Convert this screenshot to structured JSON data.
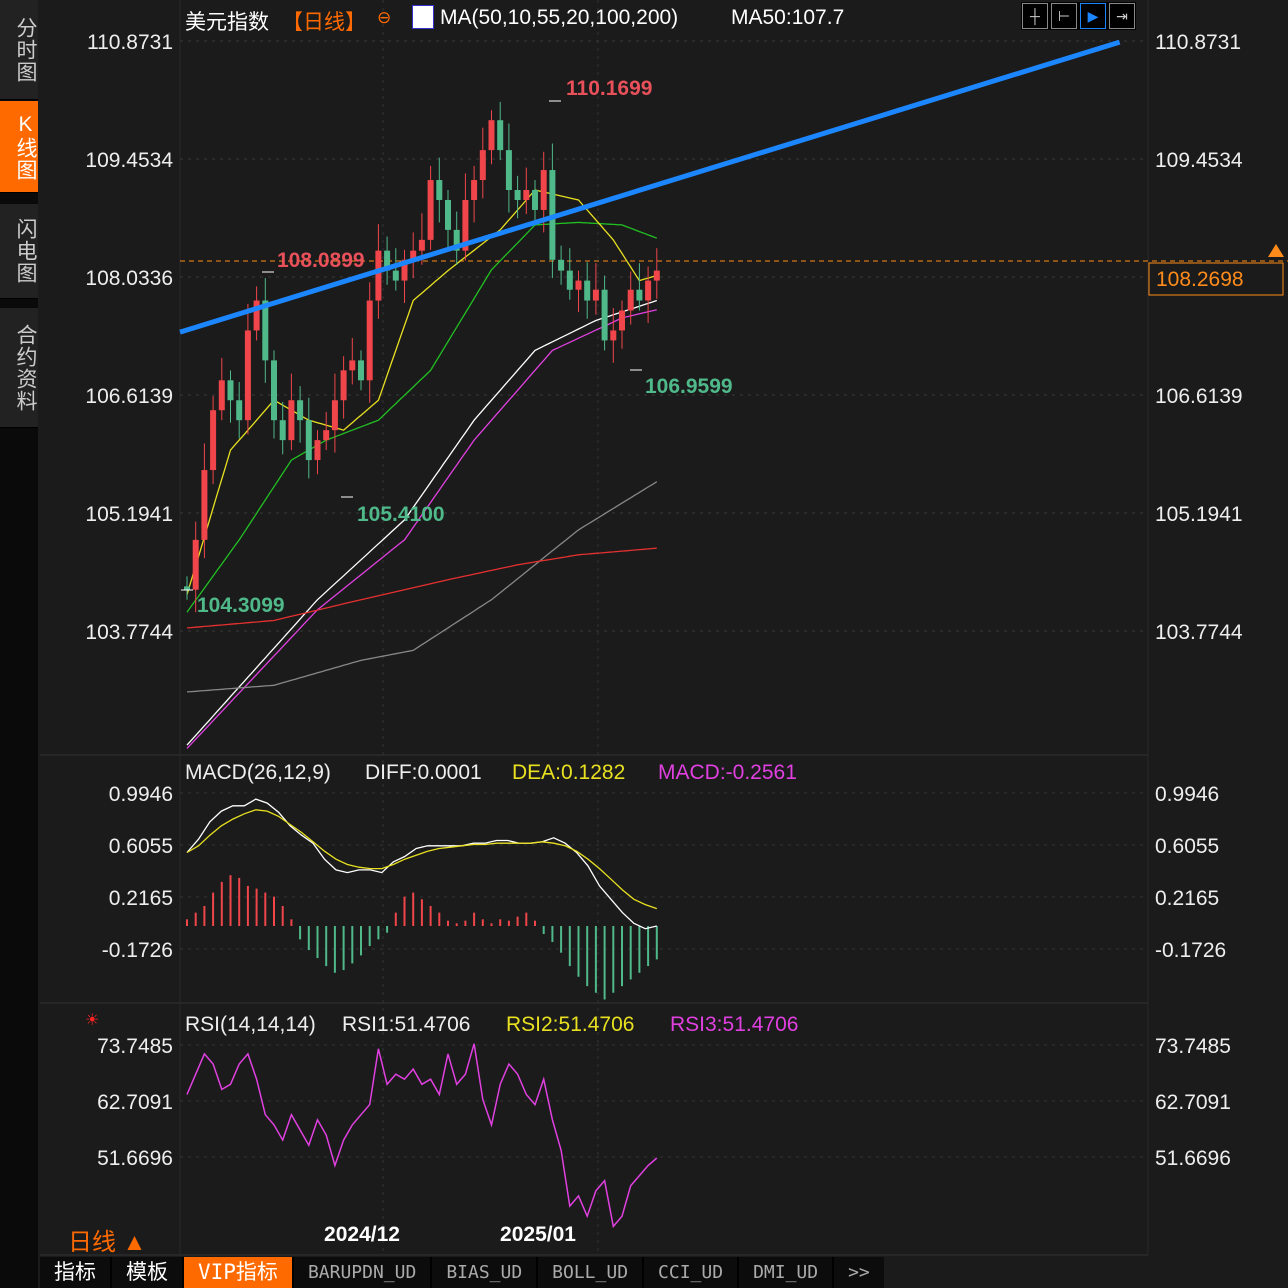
{
  "sidebar": {
    "tabs": [
      "分时图",
      "K线图",
      "闪电图",
      "合约资料"
    ],
    "active": 1
  },
  "header": {
    "title": "美元指数",
    "period": "【日线】",
    "ma_label": "MA(50,10,55,20,100,200)",
    "ma_value": "MA50:107.7"
  },
  "toolbar": {
    "icons": [
      "crosshair-icon",
      "range-icon",
      "play-icon",
      "forward-icon"
    ]
  },
  "price_axis": {
    "labels": [
      "110.8731",
      "109.4534",
      "108.0336",
      "106.6139",
      "105.1941",
      "103.7744"
    ],
    "current": "108.2698"
  },
  "annotations": {
    "high": "110.1699",
    "mark1": "108.0899",
    "low1": "105.4100",
    "low2": "104.3099",
    "low3": "106.9599"
  },
  "macd": {
    "label": "MACD(26,12,9)",
    "diff": "DIFF:0.0001",
    "dea": "DEA:0.1282",
    "macd": "MACD:-0.2561",
    "axis": [
      "0.9946",
      "0.6055",
      "0.2165",
      "-0.1726"
    ]
  },
  "rsi": {
    "label": "RSI(14,14,14)",
    "rsi1": "RSI1:51.4706",
    "rsi2": "RSI2:51.4706",
    "rsi3": "RSI3:51.4706",
    "axis": [
      "73.7485",
      "62.7091",
      "51.6696"
    ]
  },
  "dates": [
    "2024/12",
    "2025/01"
  ],
  "period_switch": "日线 ▲",
  "tabs": [
    "指标",
    "模板",
    "VIP指标",
    "BARUPDN_UD",
    "BIAS_UD",
    "BOLL_UD",
    "CCI_UD",
    "DMI_UD",
    ">>"
  ],
  "colors": {
    "up": "#f0454a",
    "down": "#4fb98a",
    "accent": "#ff6a00",
    "trend": "#1c86ff"
  },
  "chart_data": {
    "type": "candlestick",
    "ylim": [
      103.7744,
      110.8731
    ],
    "closes": [
      104.27,
      104.87,
      105.71,
      106.43,
      106.79,
      106.55,
      106.31,
      107.39,
      107.75,
      107.03,
      106.31,
      106.07,
      106.55,
      106.31,
      105.83,
      106.07,
      106.19,
      106.55,
      106.91,
      107.03,
      106.79,
      107.75,
      108.35,
      108.11,
      107.99,
      108.24,
      108.35,
      108.48,
      109.2,
      108.96,
      108.6,
      108.35,
      108.96,
      109.2,
      109.56,
      109.92,
      109.56,
      109.08,
      108.96,
      109.08,
      108.84,
      109.32,
      108.24,
      108.11,
      107.88,
      107.99,
      107.75,
      107.88,
      107.27,
      107.39,
      107.63,
      107.88,
      107.75,
      107.99,
      108.11
    ],
    "open0": 104.31,
    "ma_lines": [
      {
        "color": "#ffffff",
        "pts": [
          [
            0,
            102.4
          ],
          [
            15,
            104.15
          ],
          [
            25,
            105.11
          ],
          [
            33,
            106.31
          ],
          [
            40,
            107.15
          ],
          [
            47,
            107.51
          ],
          [
            54,
            107.75
          ]
        ]
      },
      {
        "color": "#e040e0",
        "pts": [
          [
            0,
            102.36
          ],
          [
            15,
            104.03
          ],
          [
            25,
            104.87
          ],
          [
            33,
            106.07
          ],
          [
            42,
            107.15
          ],
          [
            50,
            107.54
          ],
          [
            54,
            107.64
          ]
        ]
      },
      {
        "color": "#888888",
        "pts": [
          [
            0,
            103.04
          ],
          [
            10,
            103.12
          ],
          [
            20,
            103.42
          ],
          [
            26,
            103.54
          ],
          [
            35,
            104.15
          ],
          [
            45,
            104.99
          ],
          [
            54,
            105.57
          ]
        ]
      },
      {
        "color": "#e53030",
        "pts": [
          [
            0,
            103.81
          ],
          [
            10,
            103.9
          ],
          [
            20,
            104.15
          ],
          [
            30,
            104.39
          ],
          [
            38,
            104.57
          ],
          [
            45,
            104.69
          ],
          [
            54,
            104.77
          ]
        ]
      },
      {
        "color": "#22c022",
        "pts": [
          [
            0,
            104.0
          ],
          [
            6,
            104.87
          ],
          [
            12,
            105.83
          ],
          [
            16,
            106.07
          ],
          [
            22,
            106.31
          ],
          [
            28,
            106.91
          ],
          [
            35,
            108.12
          ],
          [
            40,
            108.66
          ],
          [
            45,
            108.69
          ],
          [
            50,
            108.66
          ],
          [
            54,
            108.5
          ]
        ]
      },
      {
        "color": "#e8e020",
        "pts": [
          [
            0,
            104.21
          ],
          [
            5,
            105.95
          ],
          [
            10,
            106.55
          ],
          [
            14,
            106.31
          ],
          [
            18,
            106.19
          ],
          [
            22,
            106.55
          ],
          [
            26,
            107.75
          ],
          [
            30,
            108.11
          ],
          [
            36,
            108.6
          ],
          [
            40,
            109.08
          ],
          [
            45,
            108.96
          ],
          [
            49,
            108.48
          ],
          [
            52,
            107.99
          ],
          [
            54,
            108.05
          ]
        ]
      }
    ],
    "trendline": [
      [
        -0.8,
        107.37
      ],
      [
        107.2,
        110.86
      ]
    ],
    "macd_hist": [
      0.05,
      0.1,
      0.15,
      0.25,
      0.33,
      0.38,
      0.36,
      0.3,
      0.28,
      0.25,
      0.22,
      0.15,
      0.05,
      -0.1,
      -0.18,
      -0.24,
      -0.3,
      -0.35,
      -0.33,
      -0.28,
      -0.22,
      -0.15,
      -0.1,
      -0.05,
      0.1,
      0.22,
      0.25,
      0.2,
      0.15,
      0.1,
      0.04,
      0.02,
      0.04,
      0.1,
      0.05,
      0.02,
      0.05,
      0.04,
      0.07,
      0.1,
      0.04,
      -0.06,
      -0.12,
      -0.2,
      -0.3,
      -0.38,
      -0.45,
      -0.5,
      -0.55,
      -0.5,
      -0.45,
      -0.4,
      -0.35,
      -0.3,
      -0.25
    ],
    "diff": [
      0.55,
      0.65,
      0.78,
      0.86,
      0.9,
      0.9,
      0.95,
      0.92,
      0.85,
      0.75,
      0.68,
      0.62,
      0.5,
      0.42,
      0.4,
      0.42,
      0.42,
      0.4,
      0.48,
      0.52,
      0.58,
      0.6,
      0.6,
      0.6,
      0.6,
      0.62,
      0.62,
      0.64,
      0.64,
      0.62,
      0.62,
      0.63,
      0.66,
      0.62,
      0.55,
      0.45,
      0.3,
      0.2,
      0.1,
      0.02,
      -0.02,
      0.0
    ],
    "dea": [
      0.55,
      0.6,
      0.68,
      0.75,
      0.8,
      0.84,
      0.87,
      0.86,
      0.82,
      0.76,
      0.7,
      0.63,
      0.56,
      0.5,
      0.46,
      0.44,
      0.43,
      0.43,
      0.46,
      0.5,
      0.53,
      0.56,
      0.58,
      0.59,
      0.6,
      0.61,
      0.61,
      0.62,
      0.62,
      0.62,
      0.62,
      0.63,
      0.62,
      0.6,
      0.56,
      0.5,
      0.43,
      0.35,
      0.27,
      0.2,
      0.16,
      0.13
    ],
    "rsi": [
      64,
      68,
      72,
      70,
      65,
      66,
      70,
      72,
      67,
      60,
      58,
      55,
      60,
      57,
      54,
      59,
      56,
      50,
      55,
      58,
      60,
      62,
      73,
      66,
      68,
      67,
      69,
      66,
      67,
      64,
      72,
      66,
      68,
      74,
      63,
      58,
      66,
      70,
      68,
      64,
      62,
      67,
      59,
      53,
      42,
      44,
      40,
      45,
      47,
      38,
      40,
      46,
      48,
      50,
      51.47
    ]
  }
}
